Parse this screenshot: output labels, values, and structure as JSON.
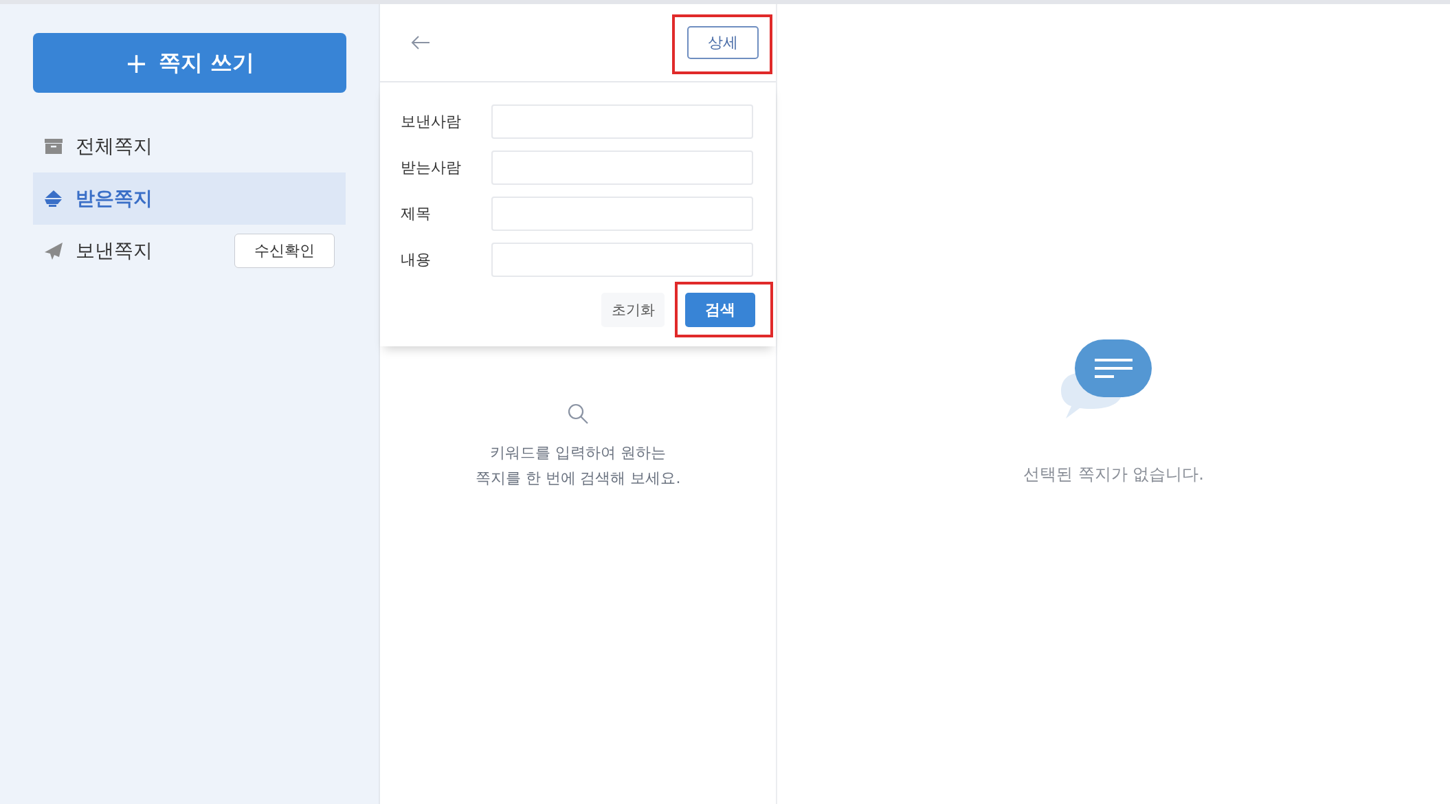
{
  "sidebar": {
    "compose_button": {
      "icon": "+",
      "label": "쪽지 쓰기"
    },
    "items": [
      {
        "kind": "archive",
        "label": "전체쪽지",
        "selected": false
      },
      {
        "kind": "inbox",
        "label": "받은쪽지",
        "selected": true
      },
      {
        "kind": "sent",
        "label": "보낸쪽지",
        "selected": false,
        "action": "수신확인"
      }
    ]
  },
  "search_panel": {
    "detail_button": "상세",
    "detail_highlighted": true,
    "fields": [
      {
        "label": "보낸사람"
      },
      {
        "label": "받는사람"
      },
      {
        "label": "제목"
      },
      {
        "label": "내용"
      }
    ],
    "reset_button": "초기화",
    "search_button": "검색",
    "search_highlighted": true,
    "empty_message": [
      "키워드를 입력하여 원하는",
      "쪽지를 한 번에 검색해 보세요."
    ]
  },
  "detail": {
    "empty_message": "선택된 쪽지가 없습니다."
  }
}
